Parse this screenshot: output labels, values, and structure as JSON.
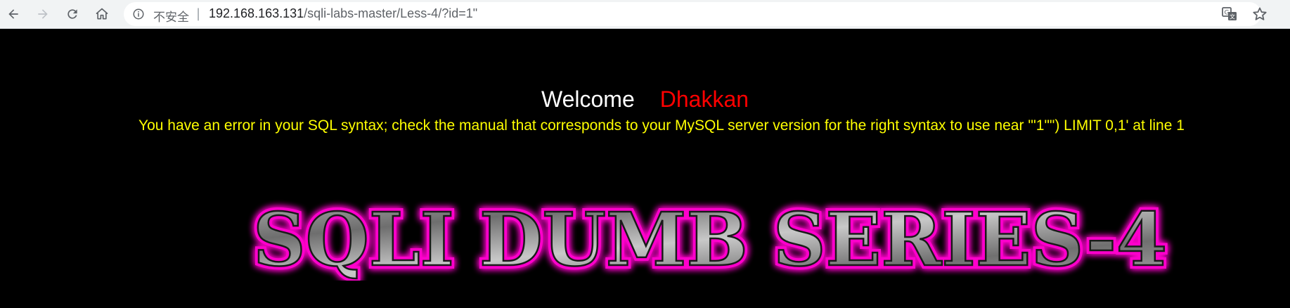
{
  "browser": {
    "security_label": "不安全",
    "separator": "|",
    "url_host": "192.168.163.131",
    "url_path": "/sqli-labs-master/Less-4/?id=1\"",
    "icons": [
      "back-icon",
      "forward-icon",
      "reload-icon",
      "home-icon",
      "info-icon",
      "translate-icon",
      "star-icon"
    ]
  },
  "page": {
    "welcome": "Welcome",
    "name": "Dhakkan",
    "error": "You have an error in your SQL syntax; check the manual that corresponds to your MySQL server version for the right syntax to use near '\"1\"\") LIMIT 0,1' at line 1",
    "banner_title": "SQLI DUMB SERIES-4"
  },
  "colors": {
    "background": "#000000",
    "welcome": "#ffffff",
    "name": "#ff0000",
    "error": "#ffff00",
    "banner_glow": "#ff00cc",
    "banner_fill": "#9a9a9a"
  }
}
